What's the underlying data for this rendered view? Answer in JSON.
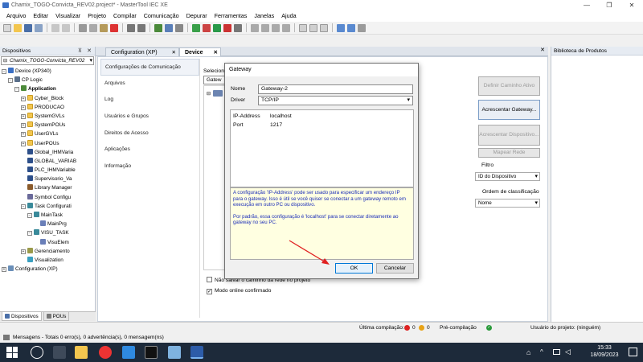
{
  "window": {
    "title": "Chamix_TOGO-Convicta_REV02.project* - MasterTool IEC XE"
  },
  "menu": [
    "Arquivo",
    "Editar",
    "Visualizar",
    "Projeto",
    "Compilar",
    "Comunicação",
    "Depurar",
    "Ferramentas",
    "Janelas",
    "Ajuda"
  ],
  "devices_panel": {
    "title": "Dispositivos",
    "combo_value": "Chamix_TOGO-Convicta_REV02",
    "tree": [
      {
        "label": "Device (XP340)",
        "depth": 1,
        "exp": "-",
        "icon": "device"
      },
      {
        "label": "CP Logic",
        "depth": 2,
        "exp": "-",
        "icon": "cpu"
      },
      {
        "label": "Application",
        "depth": 3,
        "exp": "-",
        "icon": "app",
        "bold": true
      },
      {
        "label": "Cyber_Block",
        "depth": 4,
        "exp": "+",
        "icon": "folder"
      },
      {
        "label": "PRODUCAO",
        "depth": 4,
        "exp": "+",
        "icon": "folder"
      },
      {
        "label": "SystemGVLs",
        "depth": 4,
        "exp": "+",
        "icon": "folder"
      },
      {
        "label": "SystemPOUs",
        "depth": 4,
        "exp": "+",
        "icon": "folder"
      },
      {
        "label": "UserGVLs",
        "depth": 4,
        "exp": "+",
        "icon": "folder"
      },
      {
        "label": "UserPOUs",
        "depth": 4,
        "exp": "+",
        "icon": "folder"
      },
      {
        "label": "Global_IHMVaria",
        "depth": 4,
        "exp": "",
        "icon": "gvl"
      },
      {
        "label": "GLOBAL_VARIAB",
        "depth": 4,
        "exp": "",
        "icon": "gvl"
      },
      {
        "label": "PLC_IHMVariable",
        "depth": 4,
        "exp": "",
        "icon": "gvl"
      },
      {
        "label": "Supervisorio_Va",
        "depth": 4,
        "exp": "",
        "icon": "gvl"
      },
      {
        "label": "Library Manager",
        "depth": 4,
        "exp": "",
        "icon": "lib"
      },
      {
        "label": "Symbol Configu",
        "depth": 4,
        "exp": "",
        "icon": "sym"
      },
      {
        "label": "Task Configurati",
        "depth": 4,
        "exp": "-",
        "icon": "task"
      },
      {
        "label": "MainTask",
        "depth": 5,
        "exp": "-",
        "icon": "task"
      },
      {
        "label": "MainPrg",
        "depth": 6,
        "exp": "",
        "icon": "pou"
      },
      {
        "label": "VISU_TASK",
        "depth": 5,
        "exp": "-",
        "icon": "task"
      },
      {
        "label": "VisuElem",
        "depth": 6,
        "exp": "",
        "icon": "pou"
      },
      {
        "label": "Gerenciamento",
        "depth": 4,
        "exp": "+",
        "icon": "mgr"
      },
      {
        "label": "Visualization",
        "depth": 4,
        "exp": "",
        "icon": "visu"
      },
      {
        "label": "Configuration (XP)",
        "depth": 1,
        "exp": "+",
        "icon": "config"
      }
    ],
    "bottom_tabs": [
      "Dispositivos",
      "POUs"
    ]
  },
  "doc_tabs": [
    {
      "label": "Configuration (XP)",
      "active": false
    },
    {
      "label": "Device",
      "active": true
    }
  ],
  "device_editor": {
    "nav": [
      "Configurações de Comunicação",
      "Arquivos",
      "Log",
      "Usuários e Grupos",
      "Direitos de Acesso",
      "Aplicações",
      "Informação"
    ],
    "select_label": "Selecione",
    "gateway_combo": "Gatew",
    "buttons": {
      "set_active_path": "Definir Caminho Ativo",
      "add_gateway": "Acrescentar Gateway...",
      "add_device": "Acrescentar Dispositivo...",
      "scan_network": "Mapear Rede"
    },
    "filter_label": "Filtro",
    "filter_value": "ID do Dispositivo",
    "sort_label": "Ordem de classificação",
    "sort_value": "Nome",
    "check_no_save": "Não salvar o caminho da rede no projeto",
    "check_online": "Modo online confirmado"
  },
  "products_panel": {
    "title": "Biblioteca de Produtos"
  },
  "dialog": {
    "title": "Gateway",
    "name_label": "Nome",
    "name_value": "Gateway-2",
    "driver_label": "Driver",
    "driver_value": "TCP/IP",
    "props": [
      {
        "key": "IP-Address",
        "value": "localhost"
      },
      {
        "key": "Port",
        "value": "1217"
      }
    ],
    "info_1": "A configuração 'IP-Address' pode ser usado para especificar um endereço IP para o gateway. Isso é útil se você quiser se conectar a um gateway remoto em execução em outro PC ou dispositivo.",
    "info_2": "Por padrão, essa configuração é 'localhost' para se conectar diretamente ao gateway no seu PC.",
    "ok": "OK",
    "cancel": "Cancelar"
  },
  "status": {
    "last_compile_label": "Última compilação:",
    "last_compile_errors": "0",
    "last_compile_warnings": "0",
    "precompile_label": "Pré-compilação",
    "user_label": "Usuário do projeto: (ninguém)",
    "messages": "Mensagens - Totais 0 erro(s), 0 advertência(s), 0 mensagem(ns)"
  },
  "taskbar": {
    "time": "15:33",
    "date": "18/09/2023"
  },
  "colors": {
    "accent": "#0078d7",
    "info_text": "#1a2cb8",
    "taskbar": "#1d2a3a",
    "arrow": "#e02020"
  }
}
